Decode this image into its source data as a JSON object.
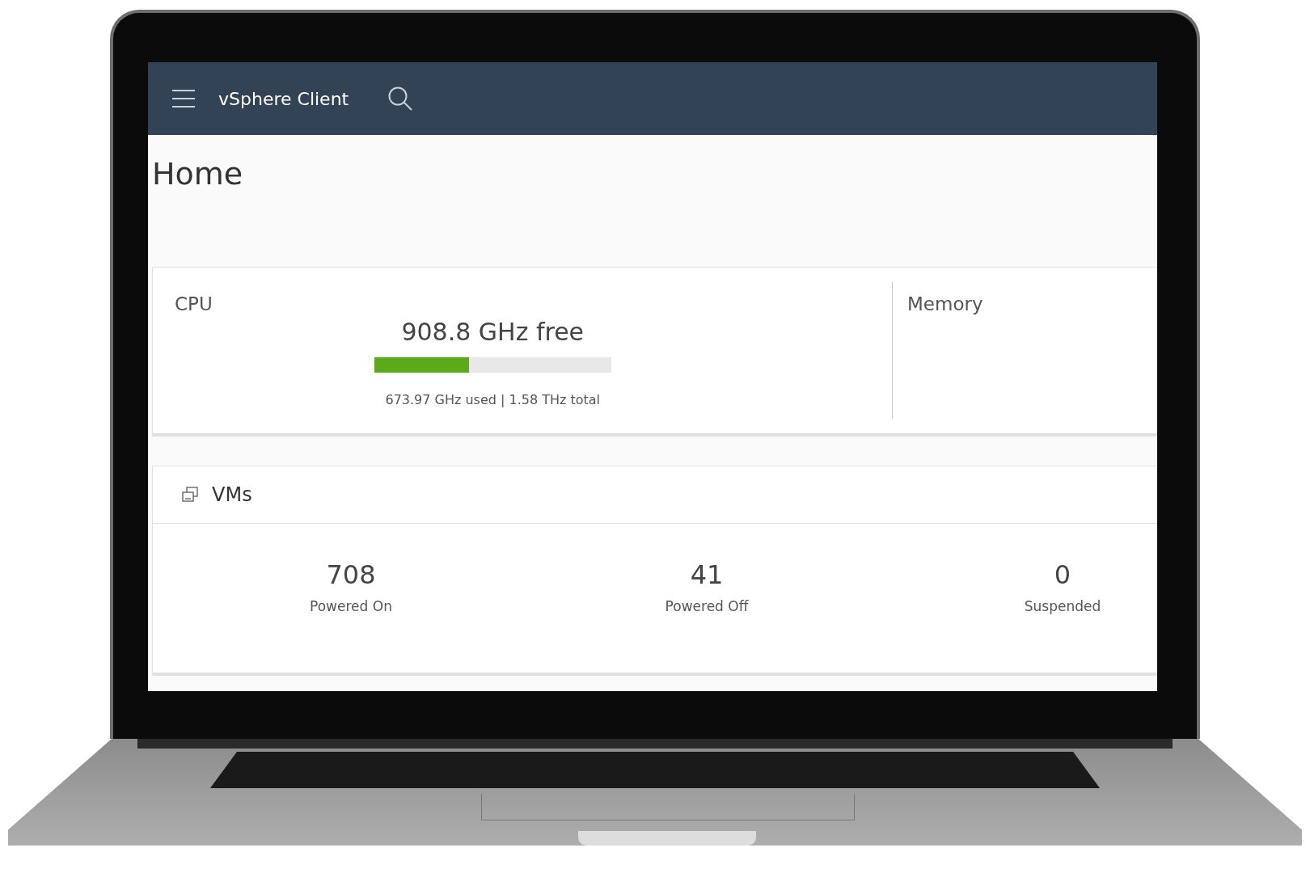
{
  "header": {
    "title": "vSphere Client"
  },
  "page": {
    "title": "Home"
  },
  "cpu": {
    "label": "CPU",
    "free": "908.8 GHz free",
    "level": 0.4,
    "detail": "673.97 GHz used | 1.58 THz total"
  },
  "memory": {
    "label": "Memory"
  },
  "vms": {
    "title": "VMs",
    "stats": [
      {
        "value": "708",
        "label": "Powered On"
      },
      {
        "value": "41",
        "label": "Powered Off"
      },
      {
        "value": "0",
        "label": "Suspended"
      }
    ]
  }
}
